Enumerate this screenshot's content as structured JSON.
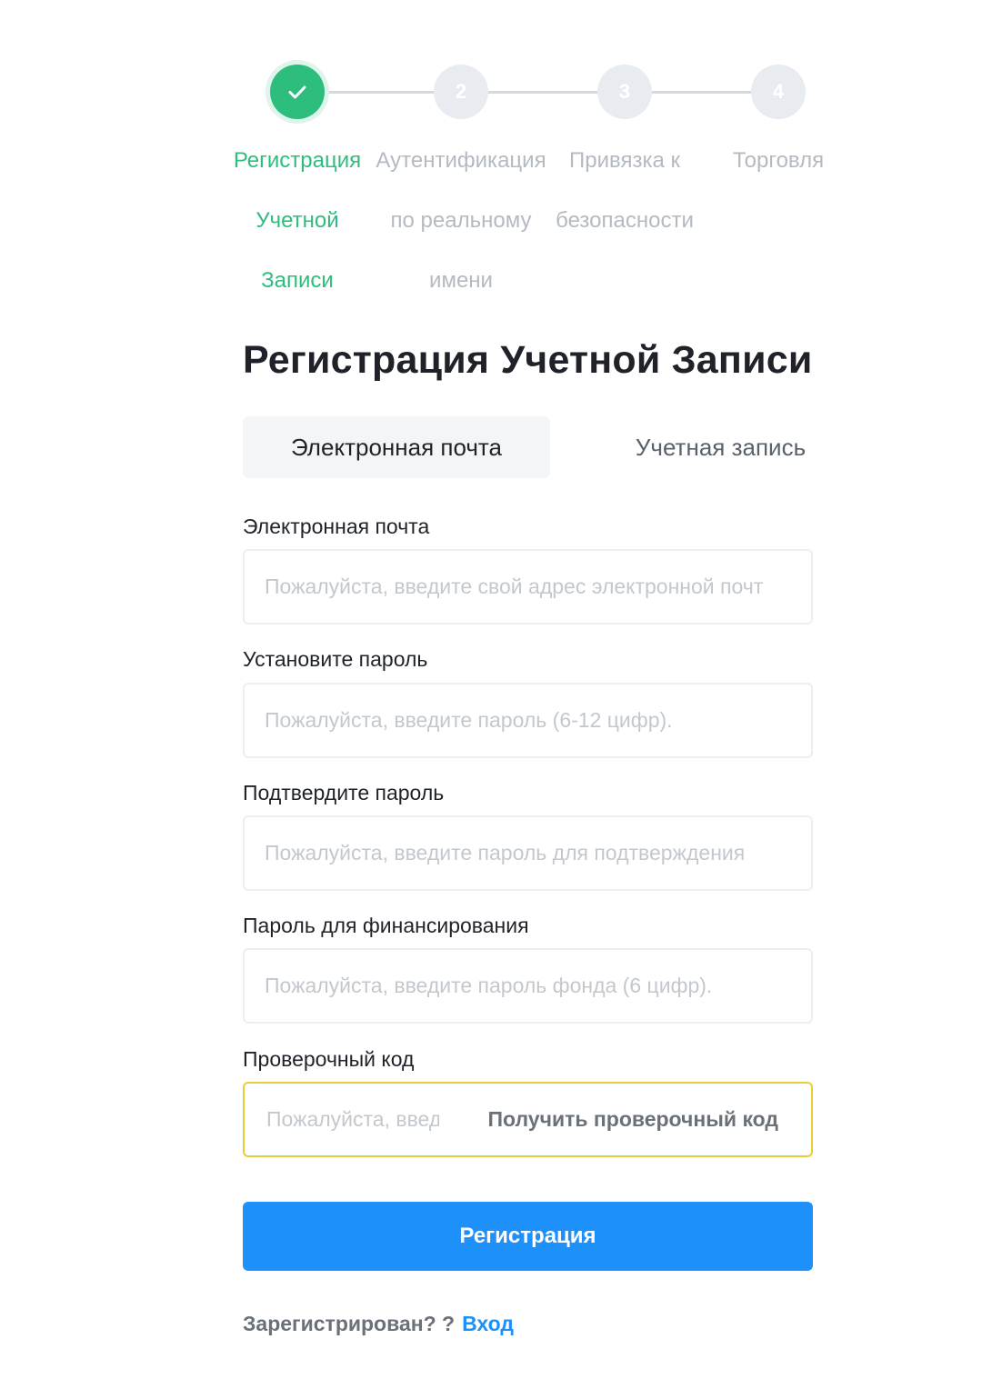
{
  "stepper": {
    "steps": [
      {
        "number": "",
        "line1": "Регистрация",
        "line2": "Учетной",
        "line3": "Записи",
        "state": "done"
      },
      {
        "number": "2",
        "line1": "Аутентификация",
        "line2": "по реальному",
        "line3": "имени",
        "state": "pending"
      },
      {
        "number": "3",
        "line1": "Привязка к",
        "line2": "безопасности",
        "line3": "",
        "state": "pending"
      },
      {
        "number": "4",
        "line1": "Торговля",
        "line2": "",
        "line3": "",
        "state": "pending"
      }
    ],
    "done_icon": "check-icon"
  },
  "form": {
    "title": "Регистрация Учетной Записи",
    "tabs": {
      "email": "Электронная почта",
      "account": "Учетная запись"
    },
    "email": {
      "label": "Электронная почта",
      "placeholder": "Пожалуйста, введите свой адрес электронной почты",
      "value": ""
    },
    "password": {
      "label": "Установите пароль",
      "placeholder": "Пожалуйста, введите пароль (6-12 цифр).",
      "value": ""
    },
    "confirm_password": {
      "label": "Подтвердите пароль",
      "placeholder": "Пожалуйста, введите пароль для подтверждения",
      "value": ""
    },
    "fund_password": {
      "label": "Пароль для финансирования",
      "placeholder": "Пожалуйста, введите пароль фонда (6 цифр).",
      "value": ""
    },
    "code": {
      "label": "Проверочный код",
      "placeholder": "Пожалуйста, введите проверочный код",
      "value": "",
      "get_code": "Получить проверочный код"
    },
    "submit": "Регистрация",
    "login_prompt": "Зарегистрирован? ?",
    "login_link": "Вход"
  },
  "colors": {
    "accent_green": "#2dbd7d",
    "primary_blue": "#1e90fa",
    "focus_yellow": "#eacb3a",
    "inactive_gray": "#b4bac2"
  }
}
